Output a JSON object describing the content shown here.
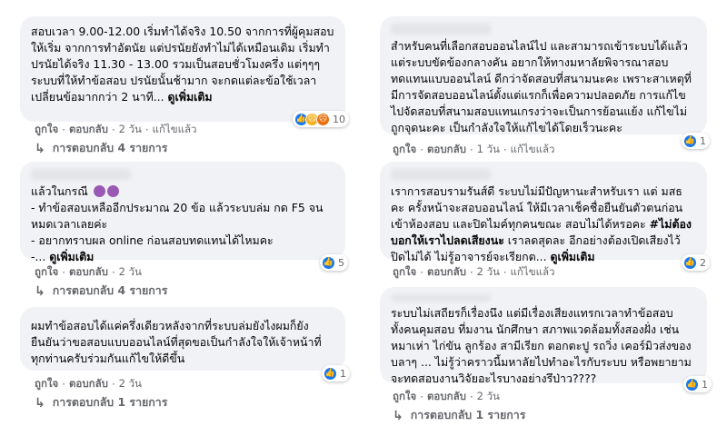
{
  "comments": [
    {
      "text_main": "สอบเวลา 9.00-12.00 เริ่มทำได้จริง 10.50 จากการที่ผู้คุมสอบให้เริ่ม จากการทำอัตนัย แต่ปรนัยยังทำไม่ได้เหมือนเดิม เริ่มทำปรนัยได้จริง 11.30 - 13.00 รวมเป็นสอบชั่วโมงครึ่ง แต่ๆๆๆ ระบบที่ให้ทำข้อสอบ ปรนัยนั้นช้ามาก จะกดแต่ละข้อใช้เวลาเปลี่ยนข้อมากกว่า 2 นาที... ",
      "see_more": "ดูเพิ่มเติม",
      "reaction_count": "10",
      "actions": {
        "like": "ถูกใจ",
        "reply": "ตอบกลับ",
        "time": "2 วัน",
        "edited": "แก้ไขแล้ว"
      },
      "replies": "การตอบกลับ 4 รายการ"
    },
    {
      "text_main": "แล้วในกรณี",
      "text_rest": "- ทำข้อสอบเหลืออีกประมาณ 20 ข้อ แล้วระบบล่ม กด F5 จนหมดเวลาเลยค่ะ\n- อยากทราบผล online ก่อนสอบทดแทนได้ไหมคะ\n-... ",
      "see_more": "ดูเพิ่มเติม",
      "reaction_count": "5",
      "actions": {
        "like": "ถูกใจ",
        "reply": "ตอบกลับ",
        "time": "2 วัน"
      },
      "replies": "การตอบกลับ 4 รายการ"
    },
    {
      "text_main": "ผมทำข้อสอบได้แค่ครึ่งเดียวหลังจากที่ระบบล่มยังไงผมก็ยังยืนยันว่าขอสอบแบบออนไลน์ที่สุดขอเป็นกำลังใจให้เจ้าหน้าที่ทุกท่านครับร่วมกันแก้ไขให้ดีขึ้น",
      "reaction_count": "1",
      "actions": {
        "like": "ถูกใจ",
        "reply": "ตอบกลับ",
        "time": "2 วัน"
      },
      "replies": "การตอบกลับ 1 รายการ"
    },
    {
      "text_main": "สำหรับคนที่เลือกสอบออนไลน์ไป และสามารถเข้าระบบได้แล้วแต่ระบบขัดข้องกลางคัน อยากให้ทางมหาลัยพิจารณาสอบทดแทนแบบออนไลน์ ดีกว่าจัดสอบที่สนามนะคะ เพราะสาเหตุที่มีการจัดสอบออนไลน์ตั้งแต่แรกก็เพื่อความปลอดภัย การแก้ไขไปจัดสอบที่สนามสอบแทนเกรงว่าจะเป็นการย้อนแย้ง แก้ไขไม่ถูกจุดนะคะ เป็นกำลังใจให้แก้ไขได้โดยเร็วนะคะ",
      "reaction_count": "1",
      "actions": {
        "like": "ถูกใจ",
        "reply": "ตอบกลับ",
        "time": "1 วัน",
        "edited": "แก้ไขแล้ว"
      },
      "replies": ""
    },
    {
      "text_main": "เราการสอบรามรันส์ดี ระบบไม่มีปัญหานะสำหรับเรา แต่ มสธ คะ ครั้งหน้าจะสอบออนไลน์ ให้มีเวลาเช็คชื่อยืนยันตัวตนก่อนเข้าห้องสอบ และปิดไมค์ทุกคนขณะ สอบไม่ได้หรอคะ ",
      "text_bold": "#ไม่ต้องบอกให้เราไปลดเสียงนะ",
      "text_after": " เราลดสุดละ อีกอย่างต้องเปิดเสียงไว้ ปิดไม่ได้ ไม่รู้อาจารย์จะเรียกต... ",
      "see_more": "ดูเพิ่มเติม",
      "reaction_count": "2",
      "actions": {
        "like": "ถูกใจ",
        "reply": "ตอบกลับ",
        "time": "2 วัน",
        "edited": "แก้ไขแล้ว"
      },
      "replies": ""
    },
    {
      "text_main": "ระบบไม่เสถียรก็เรื่องนึง แต่มีเรื่องเสียงแทรกเวลาทำข้อสอบ ทั้งคนคุมสอบ ที่มงาน นักศึกษา สภาพแวดล้อมทั้งสองฝั่ง เช่น หมาเห่า ไก่ขัน ลูกร้อง สามีเรียก ตอกตะปู รถวิ่ง เคอร์มิวส่งของ บลาๆ ... ไม่รู้ว่าคราวนี้มหาลัยไปทำอะไรกับระบบ หรือพยายามจะทดสอบงานวิจัยอะไรบางอย่างรึป่าว????",
      "reaction_count": "1",
      "actions": {
        "like": "ถูกใจ",
        "reply": "ตอบกลับ",
        "time": "2 วัน"
      },
      "replies": "การตอบกลับ 1 รายการ"
    }
  ],
  "colors": {
    "bubble": "#f0f2f5",
    "muted": "#65676b",
    "like": "#1877f2"
  },
  "icons": {
    "reply": "reply-arrow-icon",
    "like": "like-icon",
    "sad": "sad-icon",
    "angry": "angry-icon"
  }
}
